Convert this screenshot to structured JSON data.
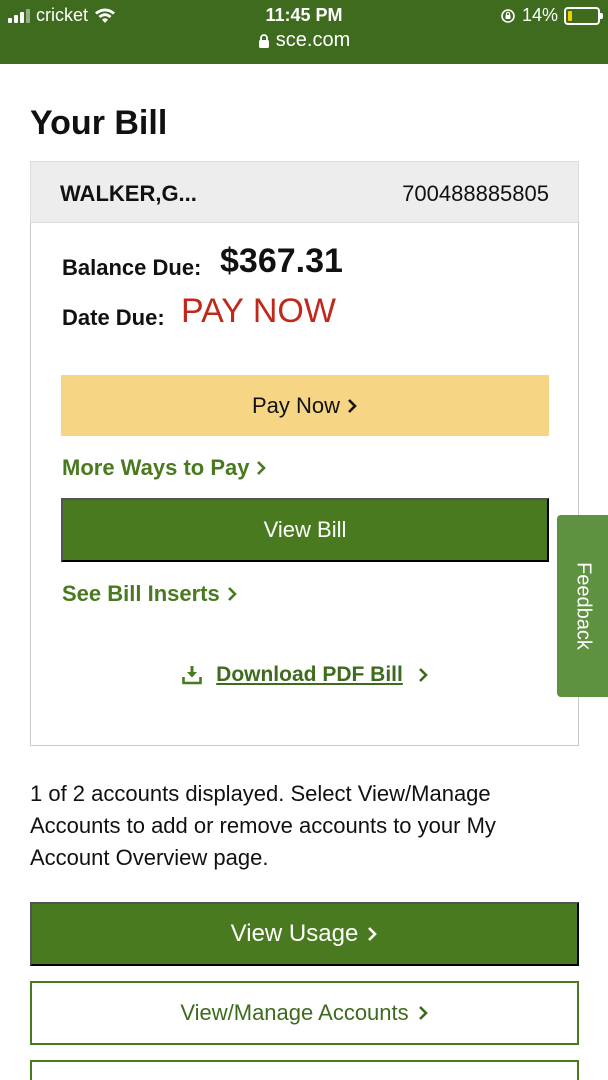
{
  "status_bar": {
    "carrier": "cricket",
    "time": "11:45 PM",
    "url": "sce.com",
    "battery": "14%",
    "battery_level": 0.14,
    "battery_color": "#f4cf00",
    "bar_color": "#3e6b1e"
  },
  "page": {
    "title": "Your Bill"
  },
  "account": {
    "name": "WALKER,G...",
    "number": "700488885805"
  },
  "bill": {
    "balance_label": "Balance Due:",
    "balance_value": "$367.31",
    "due_label": "Date Due:",
    "due_value": "PAY NOW",
    "due_color": "#c0281b"
  },
  "actions": {
    "pay_now": "Pay Now",
    "more_ways": "More Ways to Pay",
    "view_bill": "View Bill",
    "see_inserts": "See Bill Inserts",
    "download_pdf": "Download PDF Bill"
  },
  "feedback": {
    "label": "Feedback"
  },
  "note": "1 of 2 accounts displayed. Select View/Manage Accounts to add or remove accounts to your My Account Overview page.",
  "bottom_buttons": {
    "view_usage": "View Usage",
    "view_manage": "View/Manage Accounts"
  },
  "colors": {
    "brand_green": "#4a7a20",
    "pay_yellow": "#f6d584",
    "feedback_green": "#5e9140"
  },
  "icons": {
    "lock": "lock-icon",
    "wifi": "wifi-icon",
    "signal": "signal-icon",
    "orientation_lock": "orientation-lock-icon",
    "download": "download-icon",
    "chevron": "chevron-right-icon"
  }
}
